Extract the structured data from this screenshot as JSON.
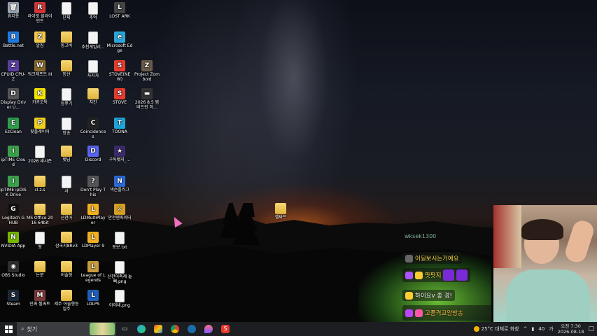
{
  "desktop": {
    "icons": [
      {
        "label": "휴지통",
        "color": "#9aa7b3",
        "glyph": "🗑",
        "type": "app"
      },
      {
        "label": "라이엇 클라이언트",
        "color": "#d13639",
        "glyph": "R",
        "type": "app"
      },
      {
        "label": "단체",
        "color": "",
        "glyph": "",
        "type": "doc"
      },
      {
        "label": "추억",
        "color": "",
        "glyph": "",
        "type": "doc"
      },
      {
        "label": "LOST ARK",
        "color": "#444",
        "glyph": "L",
        "type": "app"
      },
      {
        "label": "Battle.net",
        "color": "#1f7ae0",
        "glyph": "B",
        "type": "app"
      },
      {
        "label": "알집",
        "color": "#f3c94a",
        "glyph": "Z",
        "type": "app"
      },
      {
        "label": "동고비",
        "color": "",
        "glyph": "",
        "type": "folder"
      },
      {
        "label": "추천게임리...",
        "color": "",
        "glyph": "",
        "type": "doc"
      },
      {
        "label": "Microsoft Edge",
        "color": "#2aa6d8",
        "glyph": "e",
        "type": "app"
      },
      {
        "label": "CPUID CPU-Z",
        "color": "#5a3fa0",
        "glyph": "Z",
        "type": "app"
      },
      {
        "label": "워크래프트 III",
        "color": "#8a6a2a",
        "glyph": "W",
        "type": "app"
      },
      {
        "label": "등산",
        "color": "",
        "glyph": "",
        "type": "folder"
      },
      {
        "label": "자지자",
        "color": "",
        "glyph": "",
        "type": "doc"
      },
      {
        "label": "STOVE(NEW)",
        "color": "#e63b2e",
        "glyph": "S",
        "type": "app"
      },
      {
        "label": "Project Zomboid",
        "color": "#6b5a4a",
        "glyph": "Z",
        "type": "app"
      },
      {
        "label": "Display Driver U...",
        "color": "#555",
        "glyph": "D",
        "type": "app"
      },
      {
        "label": "카카오톡",
        "color": "#f7e600",
        "glyph": "K",
        "type": "app"
      },
      {
        "label": "등뿌기",
        "color": "",
        "glyph": "",
        "type": "doc"
      },
      {
        "label": "치킨",
        "color": "",
        "glyph": "",
        "type": "folder"
      },
      {
        "label": "STOVE",
        "color": "#e63b2e",
        "glyph": "S",
        "type": "app"
      },
      {
        "label": "2026 8.5 뱀버트린 하...",
        "color": "#333",
        "glyph": "▬",
        "type": "app"
      },
      {
        "label": "EzClean",
        "color": "#2e9e4a",
        "glyph": "E",
        "type": "app"
      },
      {
        "label": "팟플레이어",
        "color": "#f0d020",
        "glyph": "P",
        "type": "app"
      },
      {
        "label": "방송",
        "color": "",
        "glyph": "",
        "type": "doc"
      },
      {
        "label": "Coincidences",
        "color": "#222",
        "glyph": "C",
        "type": "app"
      },
      {
        "label": "TOONA",
        "color": "#1fa3d8",
        "glyph": "T",
        "type": "app"
      },
      {
        "label": "ipTIME Cloud",
        "color": "#3aa04a",
        "glyph": "i",
        "type": "app"
      },
      {
        "label": "2026 새시즌",
        "color": "",
        "glyph": "",
        "type": "doc"
      },
      {
        "label": "뱃님",
        "color": "",
        "glyph": "",
        "type": "folder"
      },
      {
        "label": "Discord",
        "color": "#5865f2",
        "glyph": "D",
        "type": "app"
      },
      {
        "label": "구독뱃지_...",
        "color": "#3a2a6a",
        "glyph": "★",
        "type": "app"
      },
      {
        "label": "ipTIME ipDISK Drive",
        "color": "#3aa04a",
        "glyph": "i",
        "type": "app"
      },
      {
        "label": "cl.z.s",
        "color": "",
        "glyph": "",
        "type": "folder"
      },
      {
        "label": "사",
        "color": "",
        "glyph": "",
        "type": "doc"
      },
      {
        "label": "Don't Play This",
        "color": "#555",
        "glyph": "?",
        "type": "app"
      },
      {
        "label": "넥슨플러그",
        "color": "#2a6ad8",
        "glyph": "N",
        "type": "app"
      },
      {
        "label": "Logitech G HUB",
        "color": "#111",
        "glyph": "G",
        "type": "app"
      },
      {
        "label": "MS Office 2016 64bit",
        "color": "",
        "glyph": "",
        "type": "folder"
      },
      {
        "label": "산천어",
        "color": "",
        "glyph": "",
        "type": "folder"
      },
      {
        "label": "LDMultiPlayer",
        "color": "#f0b020",
        "glyph": "L",
        "type": "app"
      },
      {
        "label": "안전엔파이터",
        "color": "#d8a020",
        "glyph": "⚔",
        "type": "app"
      },
      {
        "label": "NVIDIA App",
        "color": "#76b900",
        "glyph": "N",
        "type": "app"
      },
      {
        "label": "형",
        "color": "",
        "glyph": "",
        "type": "doc"
      },
      {
        "label": "삼국지8Rv3",
        "color": "",
        "glyph": "",
        "type": "folder"
      },
      {
        "label": "LDPlayer 9",
        "color": "#f0b020",
        "glyph": "L",
        "type": "app"
      },
      {
        "label": "동보.txt",
        "color": "",
        "glyph": "",
        "type": "doc"
      },
      {
        "label": "OBS Studio",
        "color": "#302e31",
        "glyph": "◉",
        "type": "app"
      },
      {
        "label": "논문",
        "color": "",
        "glyph": "",
        "type": "folder"
      },
      {
        "label": "어술형",
        "color": "",
        "glyph": "",
        "type": "folder"
      },
      {
        "label": "League of Legends",
        "color": "#c89b3c",
        "glyph": "L",
        "type": "app"
      },
      {
        "label": "산천어축제 놀뻐.png",
        "color": "",
        "glyph": "",
        "type": "doc"
      },
      {
        "label": "Steam",
        "color": "#1b2838",
        "glyph": "S",
        "type": "app"
      },
      {
        "label": "민짜 첼싸트",
        "color": "#7a3a3a",
        "glyph": "M",
        "type": "app"
      },
      {
        "label": "제주 어술형등일주",
        "color": "",
        "glyph": "",
        "type": "folder"
      },
      {
        "label": "LOLPS",
        "color": "#1f5fb8",
        "glyph": "L",
        "type": "app"
      },
      {
        "label": "아이네.png",
        "color": "",
        "glyph": "",
        "type": "doc"
      },
      {
        "label": "첼싸트",
        "color": "",
        "glyph": "",
        "type": "folder"
      }
    ]
  },
  "overlay": {
    "chat_username": "wksek1300",
    "messages": [
      {
        "text": "어딜보시는거예요",
        "color": "#f7d048"
      },
      {
        "text": "팟팟지",
        "color": "#ffd84a"
      },
      {
        "text": "하이요v 좋 경!",
        "color": "#ffffff"
      },
      {
        "text": "고품격교양방송",
        "color": "#f7b84a"
      }
    ]
  },
  "taskbar": {
    "search_placeholder": "찾기",
    "weather": "25°C 대체로 화창",
    "ime": "가",
    "volume": "40",
    "time": "오전 7:30",
    "date": "2026-08-18"
  }
}
